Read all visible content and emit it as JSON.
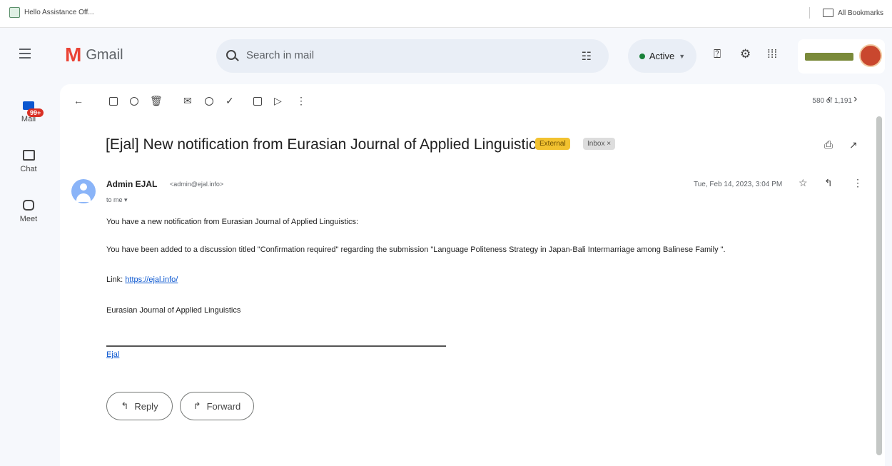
{
  "browser": {
    "bookmark_tab": "Hello Assistance Off...",
    "all_bookmarks": "All Bookmarks"
  },
  "header": {
    "app_name": "Gmail",
    "search_placeholder": "Search in mail",
    "status": "Active",
    "brand_color": "#ea4335",
    "accent_color": "#0b57d0"
  },
  "rail": {
    "mail_label": "Mail",
    "mail_badge": "99+",
    "chat_label": "Chat",
    "meet_label": "Meet"
  },
  "toolbar": {
    "paging": "580 of 1,191"
  },
  "email": {
    "subject": "[Ejal] New notification from Eurasian Journal of Applied Linguistics",
    "labels": {
      "external": "External",
      "inbox": "Inbox ×"
    },
    "sender_name": "Admin EJAL",
    "sender_email": "<admin@ejal.info>",
    "to": "to me",
    "date": "Tue, Feb 14, 2023, 3:04 PM",
    "body": {
      "line1": "You have a new notification from Eurasian Journal of Applied Linguistics:",
      "line2": "You have been added to a discussion titled \"Confirmation required\" regarding the submission \"Language Politeness Strategy in Japan-Bali Intermarriage among Balinese Family \".",
      "link_prefix": "Link:",
      "link_text": "https://ejal.info/",
      "journal": "Eurasian Journal of Applied Linguistics",
      "signature": "Ejal"
    }
  },
  "actions": {
    "reply": "Reply",
    "forward": "Forward"
  }
}
